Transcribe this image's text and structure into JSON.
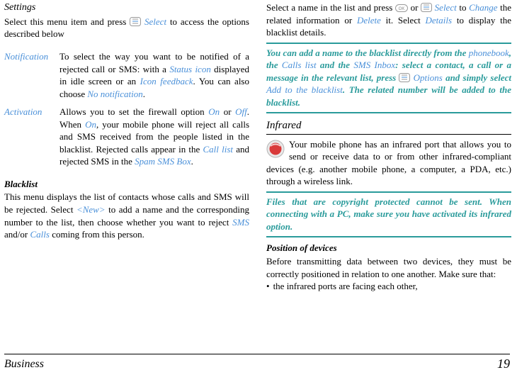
{
  "left": {
    "settings_heading": "Settings",
    "settings_intro_1": "Select this menu item and press ",
    "settings_intro_select": "Select",
    "settings_intro_2": " to access the options described below",
    "defs": [
      {
        "term": "Notification",
        "parts": [
          {
            "t": "To select the way you want to be notified of a rejected call or SMS: with a "
          },
          {
            "t": "Status icon",
            "accent": true
          },
          {
            "t": " displayed in idle screen or an "
          },
          {
            "t": "Icon feedback",
            "accent": true
          },
          {
            "t": ". You can also choose "
          },
          {
            "t": "No notification",
            "accent": true
          },
          {
            "t": "."
          }
        ]
      },
      {
        "term": "Activation",
        "parts": [
          {
            "t": "Allows you to set the firewall option "
          },
          {
            "t": "On",
            "accent": true
          },
          {
            "t": " or "
          },
          {
            "t": "Off",
            "accent": true
          },
          {
            "t": ". When "
          },
          {
            "t": "On",
            "accent": true
          },
          {
            "t": ", your mobile phone will reject all calls and SMS received from the people listed in the blacklist. Rejected calls appear in the "
          },
          {
            "t": "Call list",
            "accent": true
          },
          {
            "t": " and rejected SMS in the "
          },
          {
            "t": "Spam SMS Box",
            "accent": true
          },
          {
            "t": "."
          }
        ]
      }
    ],
    "blacklist_heading": "Blacklist",
    "blacklist_parts": [
      {
        "t": "This menu displays the list of contacts whose calls and SMS will be rejected. Select "
      },
      {
        "t": "<New>",
        "accent": true
      },
      {
        "t": " to add a name and the corresponding number to the list, then choose whether you want to reject "
      },
      {
        "t": "SMS",
        "accent": true
      },
      {
        "t": " and/or "
      },
      {
        "t": "Calls",
        "accent": true
      },
      {
        "t": " coming from this person."
      }
    ]
  },
  "right": {
    "top_parts": [
      {
        "t": "Select a name in the list and press "
      },
      {
        "icon": "ok"
      },
      {
        "t": " or "
      },
      {
        "icon": "softkey"
      },
      {
        "t": " "
      },
      {
        "t": "Select",
        "accent": true
      },
      {
        "t": " to "
      },
      {
        "t": "Change",
        "accent": true
      },
      {
        "t": " the related information or "
      },
      {
        "t": "Delete",
        "accent": true
      },
      {
        "t": " it. Select "
      },
      {
        "t": "Details",
        "accent": true
      },
      {
        "t": " to display the blacklist details."
      }
    ],
    "tip_parts": [
      {
        "t": "You can add a name to the blacklist directly from the "
      },
      {
        "t": "phonebook",
        "thin": true
      },
      {
        "t": ", the "
      },
      {
        "t": "Calls list",
        "thin": true
      },
      {
        "t": " and the "
      },
      {
        "t": "SMS Inbox",
        "thin": true
      },
      {
        "t": ": select a contact, a call or a message in the relevant list, press "
      },
      {
        "icon": "softkey"
      },
      {
        "t": " "
      },
      {
        "t": "Options",
        "thin": true
      },
      {
        "t": " and simply select "
      },
      {
        "t": "Add to the blacklist",
        "thin": true
      },
      {
        "t": ". The related number will be added to the blacklist."
      }
    ],
    "infrared_heading": "Infrared",
    "infrared_body": "Your mobile phone has an infrared port that allows you to send or receive data to or from other infrared-compliant devices (e.g. another mobile phone, a computer, a PDA, etc.) through a wireless link.",
    "infrared_tip": "Files that are copyright protected cannot be sent. When connecting with a PC, make sure you have activated its infrared option.",
    "position_heading": "Position of devices",
    "position_body": "Before transmitting data between two devices, they must be correctly positioned in relation to one another. Make sure that:",
    "position_bullet": "the infrared ports are facing each other,"
  },
  "footer": {
    "section": "Business",
    "page": "19"
  }
}
